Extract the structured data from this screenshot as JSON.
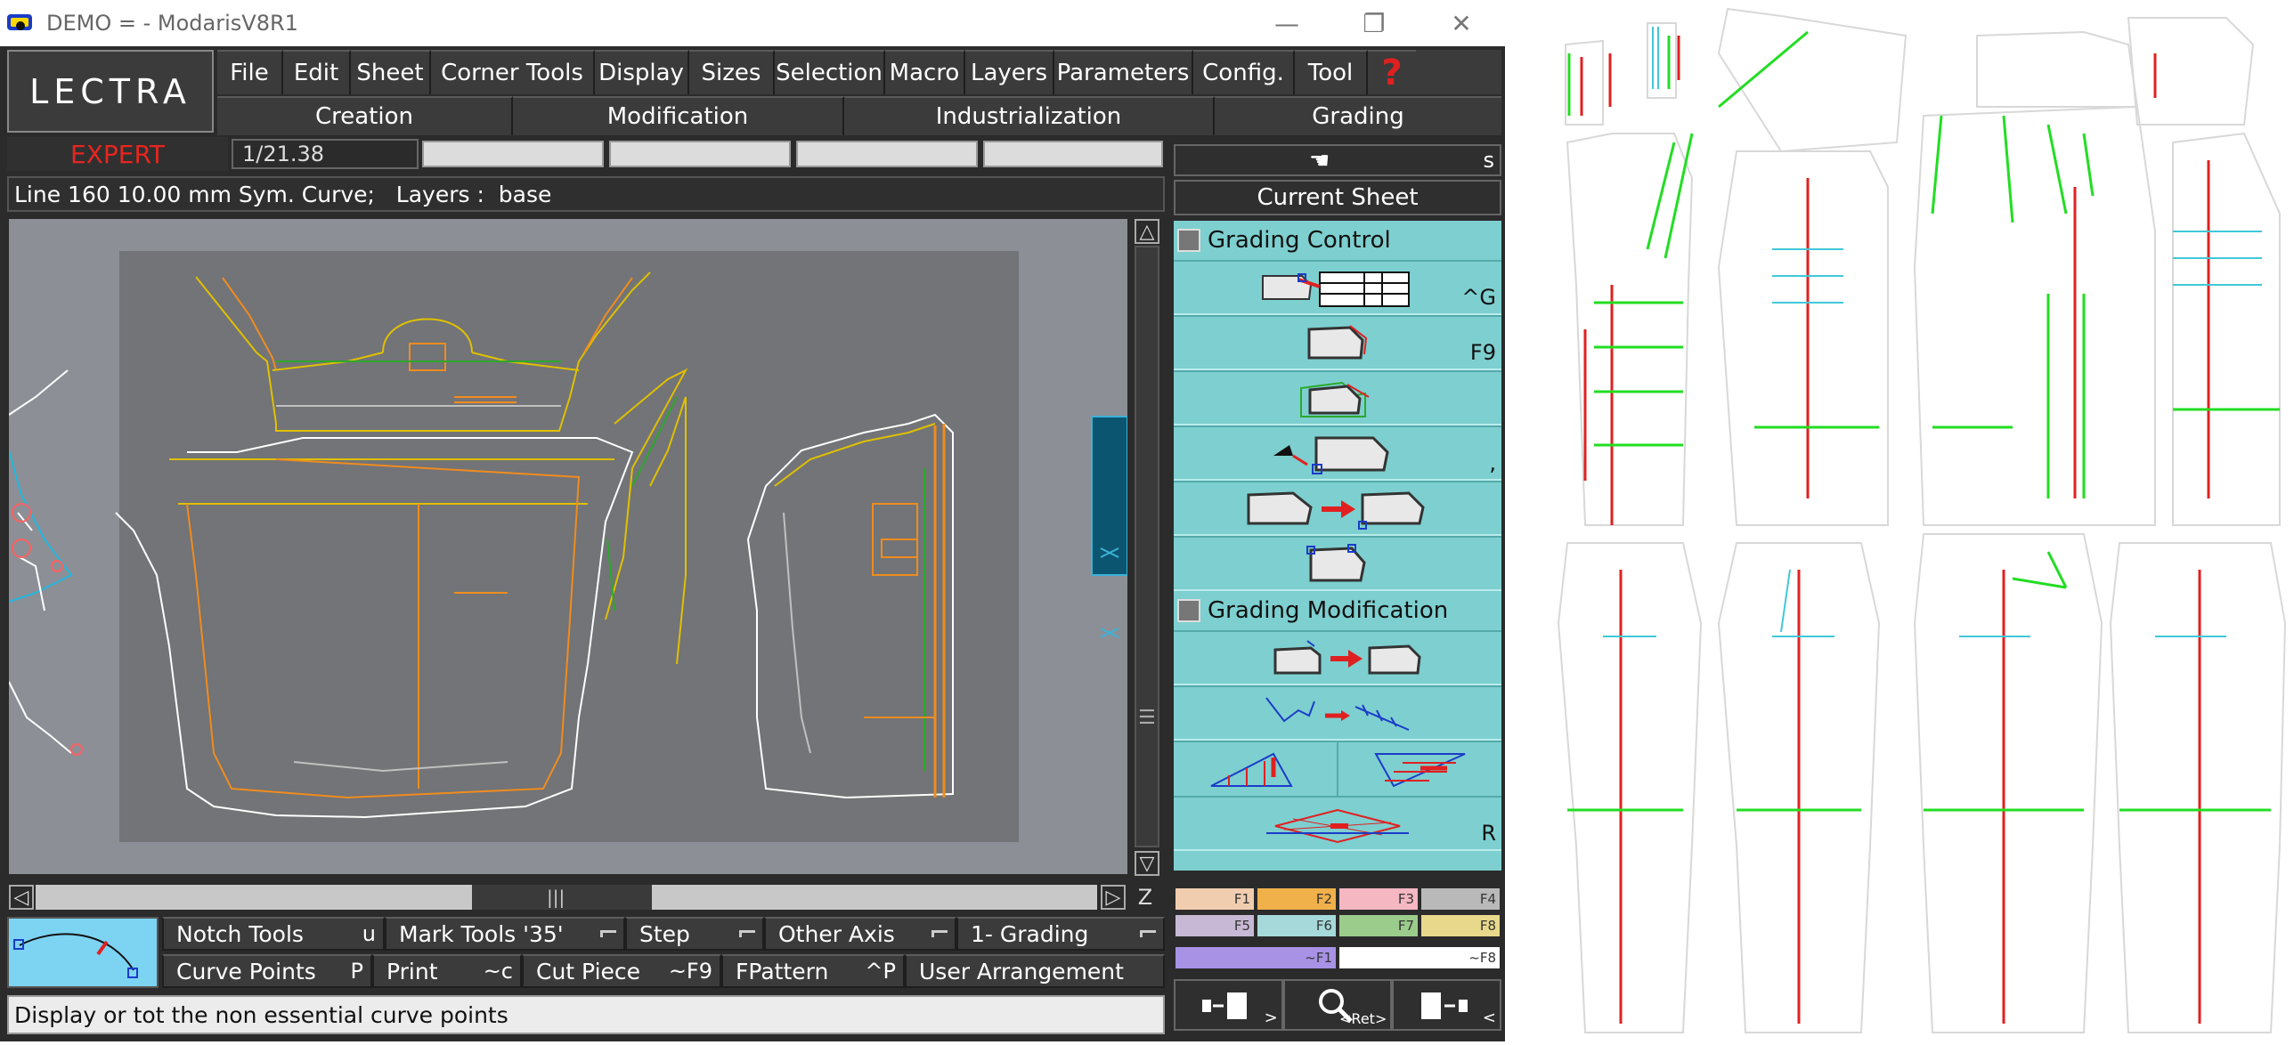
{
  "window": {
    "title": "DEMO = - ModarisV8R1",
    "minimize": "—",
    "restore": "❐",
    "close": "✕"
  },
  "logo": "LECTRA",
  "menu": [
    {
      "key": "file",
      "label": "File"
    },
    {
      "key": "edit",
      "label": "Edit"
    },
    {
      "key": "sheet",
      "label": "Sheet"
    },
    {
      "key": "corner-tools",
      "label": "Corner Tools"
    },
    {
      "key": "display",
      "label": "Display"
    },
    {
      "key": "sizes",
      "label": "Sizes"
    },
    {
      "key": "selection",
      "label": "Selection"
    },
    {
      "key": "macro",
      "label": "Macro"
    },
    {
      "key": "layers",
      "label": "Layers"
    },
    {
      "key": "parameters",
      "label": "Parameters"
    },
    {
      "key": "config",
      "label": "Config."
    },
    {
      "key": "tool",
      "label": "Tool"
    }
  ],
  "help_label": "?",
  "modes": [
    {
      "key": "creation",
      "label": "Creation"
    },
    {
      "key": "modification",
      "label": "Modification"
    },
    {
      "key": "industrialization",
      "label": "Industrialization"
    },
    {
      "key": "grading",
      "label": "Grading"
    }
  ],
  "user_level": "EXPERT",
  "scale": "1/21.38",
  "info_line": "Line 160 10.00 mm Sym. Curve;   Layers :  base",
  "scroll": {
    "up": "△",
    "down": "▽",
    "left": "◁",
    "right": "▷",
    "zoom": "Z",
    "vgrip": "☰",
    "hgrip": "|||"
  },
  "right_panel": {
    "top_key": "s",
    "current_sheet": "Current Sheet",
    "sections": [
      {
        "title": "Grading Control",
        "buttons": [
          {
            "name": "grading-table",
            "key": "^G"
          },
          {
            "name": "piece-grading",
            "key": "F9"
          },
          {
            "name": "nest-grading",
            "key": ""
          },
          {
            "name": "pick-grading",
            "key": ","
          },
          {
            "name": "copy-grading",
            "key": ""
          },
          {
            "name": "point-grading",
            "key": ""
          }
        ]
      },
      {
        "title": "Grading Modification",
        "buttons": [
          {
            "name": "modify-grading",
            "key": ""
          },
          {
            "name": "line-grading",
            "key": ""
          },
          {
            "name": "proportional-grading",
            "key": ""
          },
          {
            "name": "plane-grading",
            "key": "R"
          }
        ]
      }
    ],
    "fkeys_row1": [
      {
        "label": "F1",
        "color": "#f1cdb0"
      },
      {
        "label": "F2",
        "color": "#f0b04a"
      },
      {
        "label": "F3",
        "color": "#f5b7c2"
      },
      {
        "label": "F4",
        "color": "#b9b9b9"
      }
    ],
    "fkeys_row2": [
      {
        "label": "F5",
        "color": "#c7b9d6"
      },
      {
        "label": "F6",
        "color": "#a6dada"
      },
      {
        "label": "F7",
        "color": "#9ccc8c"
      },
      {
        "label": "F8",
        "color": "#e8d88c"
      }
    ],
    "fkeys_row3": [
      {
        "label": "~F1",
        "color": "#a792e6"
      },
      {
        "label": "~F8",
        "color": "#ffffff"
      }
    ],
    "bottom_buttons": [
      {
        "name": "previous-sheet",
        "key": ">"
      },
      {
        "name": "zoom",
        "key": "<Ret>"
      },
      {
        "name": "next-sheet",
        "key": "<"
      }
    ]
  },
  "toolbar_row1": [
    {
      "name": "notch-tools",
      "label": "Notch Tools",
      "key": "u",
      "flag": false
    },
    {
      "name": "mark-tools",
      "label": "Mark Tools '35'",
      "key": "",
      "flag": true
    },
    {
      "name": "step",
      "label": "Step",
      "key": "",
      "flag": true
    },
    {
      "name": "other-axis",
      "label": "Other Axis",
      "key": "",
      "flag": true
    },
    {
      "name": "grading-mode",
      "label": "1- Grading",
      "key": "",
      "flag": true
    }
  ],
  "toolbar_row2": [
    {
      "name": "curve-points",
      "label": "Curve Points",
      "key": "P"
    },
    {
      "name": "print",
      "label": "Print",
      "key": "~c"
    },
    {
      "name": "cut-piece",
      "label": "Cut Piece",
      "key": "~F9"
    },
    {
      "name": "fpattern",
      "label": "FPattern",
      "key": "^P"
    },
    {
      "name": "user-arrangement",
      "label": "User Arrangement",
      "key": ""
    }
  ],
  "status": "Display or tot the non essential curve points",
  "colors": {
    "accent_red": "#e8251f",
    "palette_bg": "#7ecfcf",
    "canvas_bg": "#8c8f96",
    "sheet_bg": "#727477",
    "pattern_yellow": "#e0c000",
    "pattern_orange": "#f08c1e",
    "overview_green": "#22dd22",
    "overview_red": "#e02020",
    "overview_cyan": "#40c8d8"
  }
}
